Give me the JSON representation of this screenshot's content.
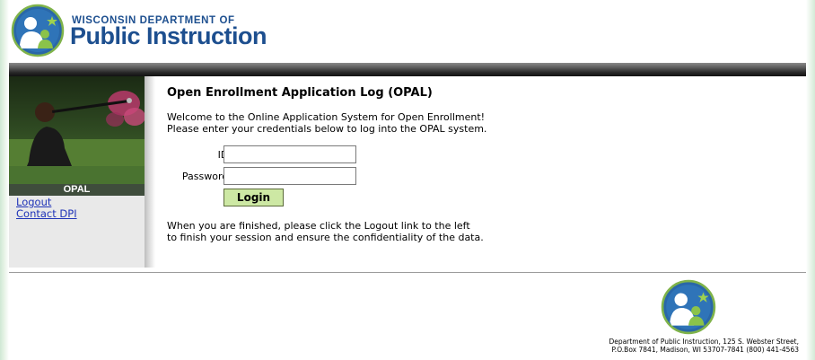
{
  "header": {
    "org_line1": "WISCONSIN DEPARTMENT OF",
    "org_line2": "Public Instruction",
    "logo_icon": "dpi-child-reading-logo"
  },
  "sidebar": {
    "photo_caption": "OPAL",
    "links": [
      {
        "label": "Logout"
      },
      {
        "label": "Contact DPI"
      }
    ]
  },
  "main": {
    "title": "Open Enrollment Application Log (OPAL)",
    "intro_line1": "Welcome to the Online Application System for Open Enrollment!",
    "intro_line2": "Please enter your credentials below to log into the OPAL system.",
    "form": {
      "id_label": "ID:",
      "id_value": "",
      "password_label": "Password:",
      "password_value": "",
      "login_label": "Login"
    },
    "outro_line1": "When you are finished, please click the Logout link to the left",
    "outro_line2": "to finish your session and ensure the confidentiality of the data."
  },
  "footer": {
    "address_line1": "Department of Public Instruction, 125 S. Webster Street,",
    "address_line2": "P.O.Box 7841, Madison, WI  53707-7841 (800) 441-4563"
  },
  "colors": {
    "brand_blue": "#1d4f8f",
    "link_blue": "#2034b8",
    "button_green": "#cde8a4",
    "caption_bar": "#3f4d3c"
  }
}
